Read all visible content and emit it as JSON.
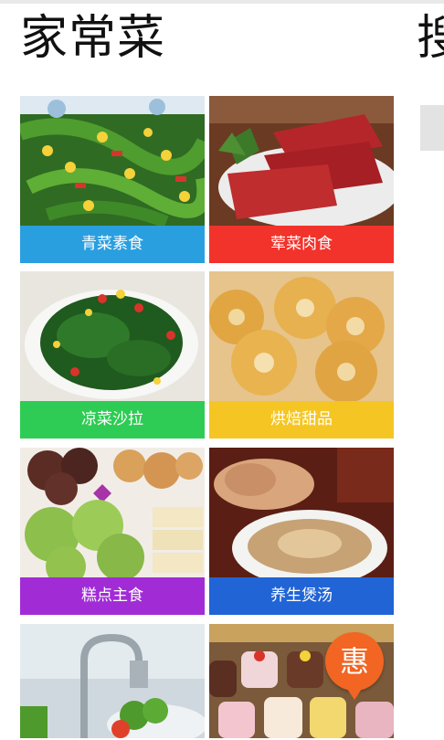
{
  "page": {
    "title": "家常菜",
    "next_title_peek": "搜"
  },
  "categories": [
    {
      "label": "青菜素食",
      "color": "#2a9fdf",
      "image": "stir-fried-snow-peas-corn"
    },
    {
      "label": "荤菜肉食",
      "color": "#f2332b",
      "image": "sliced-raw-beef"
    },
    {
      "label": "凉菜沙拉",
      "color": "#2ecc54",
      "image": "spinach-peanut-salad"
    },
    {
      "label": "烘焙甜品",
      "color": "#f5c623",
      "image": "baked-donuts"
    },
    {
      "label": "糕点主食",
      "color": "#a12cd6",
      "image": "pastries-and-buns"
    },
    {
      "label": "养生煲汤",
      "color": "#2064d6",
      "image": "chicken-soup-pot"
    }
  ],
  "partial_tiles": [
    {
      "image": "kitchen-faucet-vegetables"
    },
    {
      "image": "cupcakes-display"
    }
  ],
  "promo_badge": {
    "label": "惠",
    "color": "#f26522"
  }
}
